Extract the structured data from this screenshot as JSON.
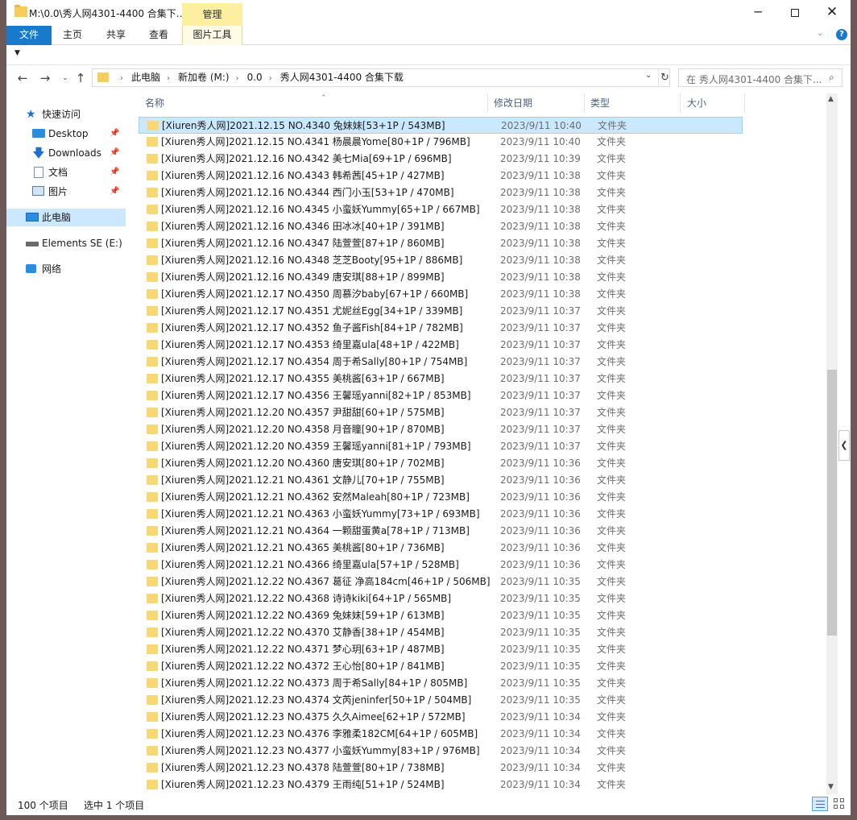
{
  "window": {
    "title": "M:\\0.0\\秀人网4301-4400 合集下...",
    "context_tab": "管理",
    "minimize_icon": "─",
    "close_icon": "✕"
  },
  "ribbon": {
    "tabs": [
      "文件",
      "主页",
      "共享",
      "查看",
      "图片工具"
    ],
    "expand_icon": "chevron-down",
    "help_icon": "?"
  },
  "nav": {
    "back": "←",
    "forward": "→",
    "recent": "⌄",
    "up": "↑"
  },
  "address": {
    "crumbs": [
      "此电脑",
      "新加卷 (M:)",
      "0.0",
      "秀人网4301-4400 合集下载"
    ],
    "separator": "›",
    "dropdown": "⌄",
    "refresh": "↻"
  },
  "search": {
    "placeholder": "在 秀人网4301-4400 合集下...",
    "icon": "⌕"
  },
  "navpane": {
    "quick_access": "快速访问",
    "desktop": "Desktop",
    "downloads": "Downloads",
    "documents": "文档",
    "pictures": "图片",
    "this_pc": "此电脑",
    "drive": "Elements SE (E:)",
    "network": "网络",
    "pin": "📌"
  },
  "columns": {
    "name": "名称",
    "date": "修改日期",
    "type": "类型",
    "size": "大小"
  },
  "files": [
    {
      "name": "[Xiuren秀人网]2021.12.15 NO.4340 兔妹妹[53+1P / 543MB]",
      "date": "2023/9/11 10:40",
      "type": "文件夹"
    },
    {
      "name": "[Xiuren秀人网]2021.12.15 NO.4341 杨晨晨Yome[80+1P / 796MB]",
      "date": "2023/9/11 10:40",
      "type": "文件夹"
    },
    {
      "name": "[Xiuren秀人网]2021.12.16 NO.4342 美七Mia[69+1P / 696MB]",
      "date": "2023/9/11 10:39",
      "type": "文件夹"
    },
    {
      "name": "[Xiuren秀人网]2021.12.16 NO.4343 韩希茜[45+1P / 427MB]",
      "date": "2023/9/11 10:38",
      "type": "文件夹"
    },
    {
      "name": "[Xiuren秀人网]2021.12.16 NO.4344 西门小玉[53+1P / 470MB]",
      "date": "2023/9/11 10:38",
      "type": "文件夹"
    },
    {
      "name": "[Xiuren秀人网]2021.12.16 NO.4345 小蛮妖Yummy[65+1P / 667MB]",
      "date": "2023/9/11 10:38",
      "type": "文件夹"
    },
    {
      "name": "[Xiuren秀人网]2021.12.16 NO.4346 田冰冰[40+1P / 391MB]",
      "date": "2023/9/11 10:38",
      "type": "文件夹"
    },
    {
      "name": "[Xiuren秀人网]2021.12.16 NO.4347 陆萱萱[87+1P / 860MB]",
      "date": "2023/9/11 10:38",
      "type": "文件夹"
    },
    {
      "name": "[Xiuren秀人网]2021.12.16 NO.4348 芝芝Booty[95+1P / 886MB]",
      "date": "2023/9/11 10:38",
      "type": "文件夹"
    },
    {
      "name": "[Xiuren秀人网]2021.12.16 NO.4349 唐安琪[88+1P / 899MB]",
      "date": "2023/9/11 10:38",
      "type": "文件夹"
    },
    {
      "name": "[Xiuren秀人网]2021.12.17 NO.4350 周慕汐baby[67+1P / 660MB]",
      "date": "2023/9/11 10:38",
      "type": "文件夹"
    },
    {
      "name": "[Xiuren秀人网]2021.12.17 NO.4351 尤妮丝Egg[34+1P / 339MB]",
      "date": "2023/9/11 10:37",
      "type": "文件夹"
    },
    {
      "name": "[Xiuren秀人网]2021.12.17 NO.4352 鱼子酱Fish[84+1P / 782MB]",
      "date": "2023/9/11 10:37",
      "type": "文件夹"
    },
    {
      "name": "[Xiuren秀人网]2021.12.17 NO.4353 绮里嘉ula[48+1P / 422MB]",
      "date": "2023/9/11 10:37",
      "type": "文件夹"
    },
    {
      "name": "[Xiuren秀人网]2021.12.17 NO.4354 周于希Sally[80+1P / 754MB]",
      "date": "2023/9/11 10:37",
      "type": "文件夹"
    },
    {
      "name": "[Xiuren秀人网]2021.12.17 NO.4355 美桃酱[63+1P / 667MB]",
      "date": "2023/9/11 10:37",
      "type": "文件夹"
    },
    {
      "name": "[Xiuren秀人网]2021.12.17 NO.4356 王馨瑶yanni[82+1P / 853MB]",
      "date": "2023/9/11 10:37",
      "type": "文件夹"
    },
    {
      "name": "[Xiuren秀人网]2021.12.20 NO.4357 尹甜甜[60+1P / 575MB]",
      "date": "2023/9/11 10:37",
      "type": "文件夹"
    },
    {
      "name": "[Xiuren秀人网]2021.12.20 NO.4358 月音瞳[90+1P / 870MB]",
      "date": "2023/9/11 10:37",
      "type": "文件夹"
    },
    {
      "name": "[Xiuren秀人网]2021.12.20 NO.4359 王馨瑶yanni[81+1P / 793MB]",
      "date": "2023/9/11 10:37",
      "type": "文件夹"
    },
    {
      "name": "[Xiuren秀人网]2021.12.20 NO.4360 唐安琪[80+1P / 702MB]",
      "date": "2023/9/11 10:36",
      "type": "文件夹"
    },
    {
      "name": "[Xiuren秀人网]2021.12.21 NO.4361 文静儿[70+1P / 755MB]",
      "date": "2023/9/11 10:36",
      "type": "文件夹"
    },
    {
      "name": "[Xiuren秀人网]2021.12.21 NO.4362 安然Maleah[80+1P / 723MB]",
      "date": "2023/9/11 10:36",
      "type": "文件夹"
    },
    {
      "name": "[Xiuren秀人网]2021.12.21 NO.4363 小蛮妖Yummy[73+1P / 693MB]",
      "date": "2023/9/11 10:36",
      "type": "文件夹"
    },
    {
      "name": "[Xiuren秀人网]2021.12.21 NO.4364 一颗甜蛋黄a[78+1P / 713MB]",
      "date": "2023/9/11 10:36",
      "type": "文件夹"
    },
    {
      "name": "[Xiuren秀人网]2021.12.21 NO.4365 美桃酱[80+1P / 736MB]",
      "date": "2023/9/11 10:36",
      "type": "文件夹"
    },
    {
      "name": "[Xiuren秀人网]2021.12.21 NO.4366 绮里嘉ula[57+1P / 528MB]",
      "date": "2023/9/11 10:36",
      "type": "文件夹"
    },
    {
      "name": "[Xiuren秀人网]2021.12.22 NO.4367 葛征 净高184cm[46+1P / 506MB]",
      "date": "2023/9/11 10:35",
      "type": "文件夹"
    },
    {
      "name": "[Xiuren秀人网]2021.12.22 NO.4368 诗诗kiki[64+1P / 565MB]",
      "date": "2023/9/11 10:35",
      "type": "文件夹"
    },
    {
      "name": "[Xiuren秀人网]2021.12.22 NO.4369 兔妹妹[59+1P / 613MB]",
      "date": "2023/9/11 10:35",
      "type": "文件夹"
    },
    {
      "name": "[Xiuren秀人网]2021.12.22 NO.4370 艾静香[38+1P / 454MB]",
      "date": "2023/9/11 10:35",
      "type": "文件夹"
    },
    {
      "name": "[Xiuren秀人网]2021.12.22 NO.4371 梦心玥[63+1P / 487MB]",
      "date": "2023/9/11 10:35",
      "type": "文件夹"
    },
    {
      "name": "[Xiuren秀人网]2021.12.22 NO.4372 王心怡[80+1P / 841MB]",
      "date": "2023/9/11 10:35",
      "type": "文件夹"
    },
    {
      "name": "[Xiuren秀人网]2021.12.22 NO.4373 周于希Sally[84+1P / 805MB]",
      "date": "2023/9/11 10:35",
      "type": "文件夹"
    },
    {
      "name": "[Xiuren秀人网]2021.12.23 NO.4374 文芮jeninfer[50+1P / 504MB]",
      "date": "2023/9/11 10:35",
      "type": "文件夹"
    },
    {
      "name": "[Xiuren秀人网]2021.12.23 NO.4375 久久Aimee[62+1P / 572MB]",
      "date": "2023/9/11 10:34",
      "type": "文件夹"
    },
    {
      "name": "[Xiuren秀人网]2021.12.23 NO.4376 李雅柔182CM[64+1P / 605MB]",
      "date": "2023/9/11 10:34",
      "type": "文件夹"
    },
    {
      "name": "[Xiuren秀人网]2021.12.23 NO.4377 小蛮妖Yummy[83+1P / 976MB]",
      "date": "2023/9/11 10:34",
      "type": "文件夹"
    },
    {
      "name": "[Xiuren秀人网]2021.12.23 NO.4378 陆萱萱[80+1P / 738MB]",
      "date": "2023/9/11 10:34",
      "type": "文件夹"
    },
    {
      "name": "[Xiuren秀人网]2021.12.23 NO.4379 王雨纯[51+1P / 524MB]",
      "date": "2023/9/11 10:34",
      "type": "文件夹"
    }
  ],
  "selected_index": 0,
  "status": {
    "count": "100 个项目",
    "selected": "选中 1 个项目"
  },
  "colors": {
    "accent": "#1979ca",
    "selection": "#cce8ff",
    "folder": "#f8d775",
    "context_tab": "#fcf0a0"
  }
}
